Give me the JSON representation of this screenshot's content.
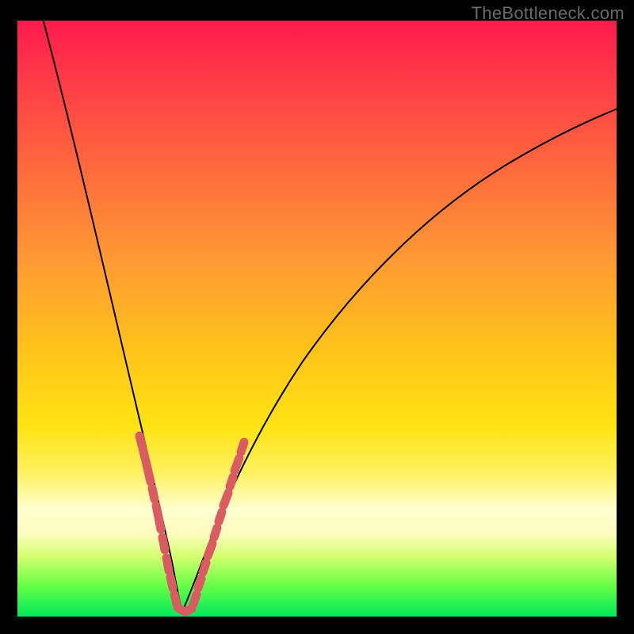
{
  "watermark": "TheBottleneck.com",
  "colors": {
    "accent": "#db5b63",
    "curve": "#000000",
    "frame": "#000000"
  },
  "chart_data": {
    "type": "line",
    "title": "",
    "xlabel": "",
    "ylabel": "",
    "xlim": [
      0,
      100
    ],
    "ylim": [
      0,
      100
    ],
    "series": [
      {
        "name": "bottleneck-curve",
        "x_pct": [
          4,
          6,
          8,
          10,
          12,
          14,
          16,
          18,
          19,
          20,
          21,
          22,
          23,
          24,
          25,
          26,
          27,
          28,
          30,
          33,
          37,
          42,
          48,
          55,
          63,
          72,
          82,
          92,
          100
        ],
        "y_pct": [
          100,
          90,
          80,
          70,
          60,
          50,
          42,
          34,
          30,
          26,
          22,
          18,
          14,
          10,
          6,
          3,
          1,
          0,
          1,
          5,
          12,
          22,
          34,
          46,
          58,
          68,
          76,
          82,
          87
        ]
      }
    ],
    "accent_clusters": [
      {
        "name": "left-dots",
        "points_pct": [
          {
            "x": 20.0,
            "y": 30.0
          },
          {
            "x": 20.6,
            "y": 28.0
          },
          {
            "x": 21.2,
            "y": 26.0
          },
          {
            "x": 22.0,
            "y": 22.0
          },
          {
            "x": 22.7,
            "y": 18.5
          },
          {
            "x": 23.4,
            "y": 15.0
          },
          {
            "x": 24.0,
            "y": 11.5
          },
          {
            "x": 24.6,
            "y": 8.5
          },
          {
            "x": 25.0,
            "y": 6.0
          },
          {
            "x": 25.6,
            "y": 3.5
          },
          {
            "x": 26.2,
            "y": 1.8
          }
        ]
      },
      {
        "name": "right-dots",
        "points_pct": [
          {
            "x": 27.8,
            "y": 0.8
          },
          {
            "x": 28.6,
            "y": 2.0
          },
          {
            "x": 29.4,
            "y": 3.8
          },
          {
            "x": 30.3,
            "y": 6.0
          },
          {
            "x": 31.2,
            "y": 8.5
          },
          {
            "x": 32.1,
            "y": 11.2
          },
          {
            "x": 33.0,
            "y": 14.0
          },
          {
            "x": 33.8,
            "y": 16.5
          },
          {
            "x": 34.6,
            "y": 19.0
          },
          {
            "x": 35.4,
            "y": 21.5
          },
          {
            "x": 36.2,
            "y": 24.0
          },
          {
            "x": 37.0,
            "y": 26.4
          }
        ]
      },
      {
        "name": "vertex-dots",
        "points_pct": [
          {
            "x": 26.6,
            "y": 0.8
          },
          {
            "x": 27.2,
            "y": 0.4
          }
        ]
      }
    ],
    "notes": "y_pct measures distance above the green minimum (0) toward the red top (100). The V-shaped curve bottoms near x≈27%."
  }
}
